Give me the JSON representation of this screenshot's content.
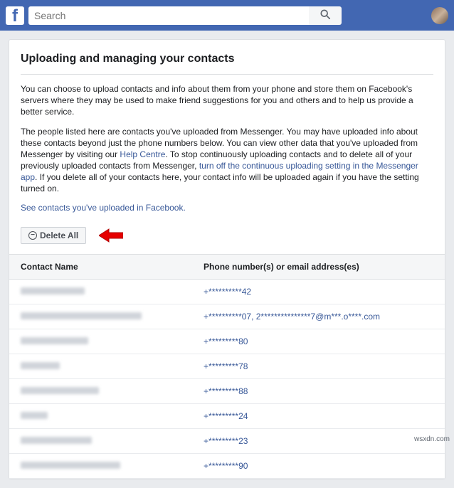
{
  "header": {
    "search_placeholder": "Search"
  },
  "page": {
    "title": "Uploading and managing your contacts",
    "para1": "You can choose to upload contacts and info about them from your phone and store them on Facebook's servers where they may be used to make friend suggestions for you and others and to help us provide a better service.",
    "para2_a": "The people listed here are contacts you've uploaded from Messenger. You may have uploaded info about these contacts beyond just the phone numbers below. You can view other data that you've uploaded from Messenger by visiting our ",
    "help_centre": "Help Centre",
    "para2_b": ". To stop continuously uploading contacts and to delete all of your previously uploaded contacts from Messenger, ",
    "turn_off_link": "turn off the continuous uploading setting in the Messenger app",
    "para2_c": ". If you delete all of your contacts here, your contact info will be uploaded again if you have the setting turned on.",
    "see_uploaded_link": "See contacts you've uploaded in Facebook.",
    "delete_all": "Delete All",
    "col_name": "Contact Name",
    "col_phone": "Phone number(s) or email address(es)"
  },
  "contacts": [
    {
      "nameBlurW": 90,
      "phone": "+**********42"
    },
    {
      "nameBlurW": 170,
      "phone": "+**********07, 2***************7@m***.o****.com"
    },
    {
      "nameBlurW": 95,
      "phone": "+*********80"
    },
    {
      "nameBlurW": 55,
      "phone": "+*********78"
    },
    {
      "nameBlurW": 110,
      "phone": "+*********88"
    },
    {
      "nameBlurW": 38,
      "phone": "+*********24"
    },
    {
      "nameBlurW": 100,
      "phone": "+*********23"
    },
    {
      "nameBlurW": 140,
      "phone": "+*********90"
    }
  ],
  "watermark": "wsxdn.com"
}
